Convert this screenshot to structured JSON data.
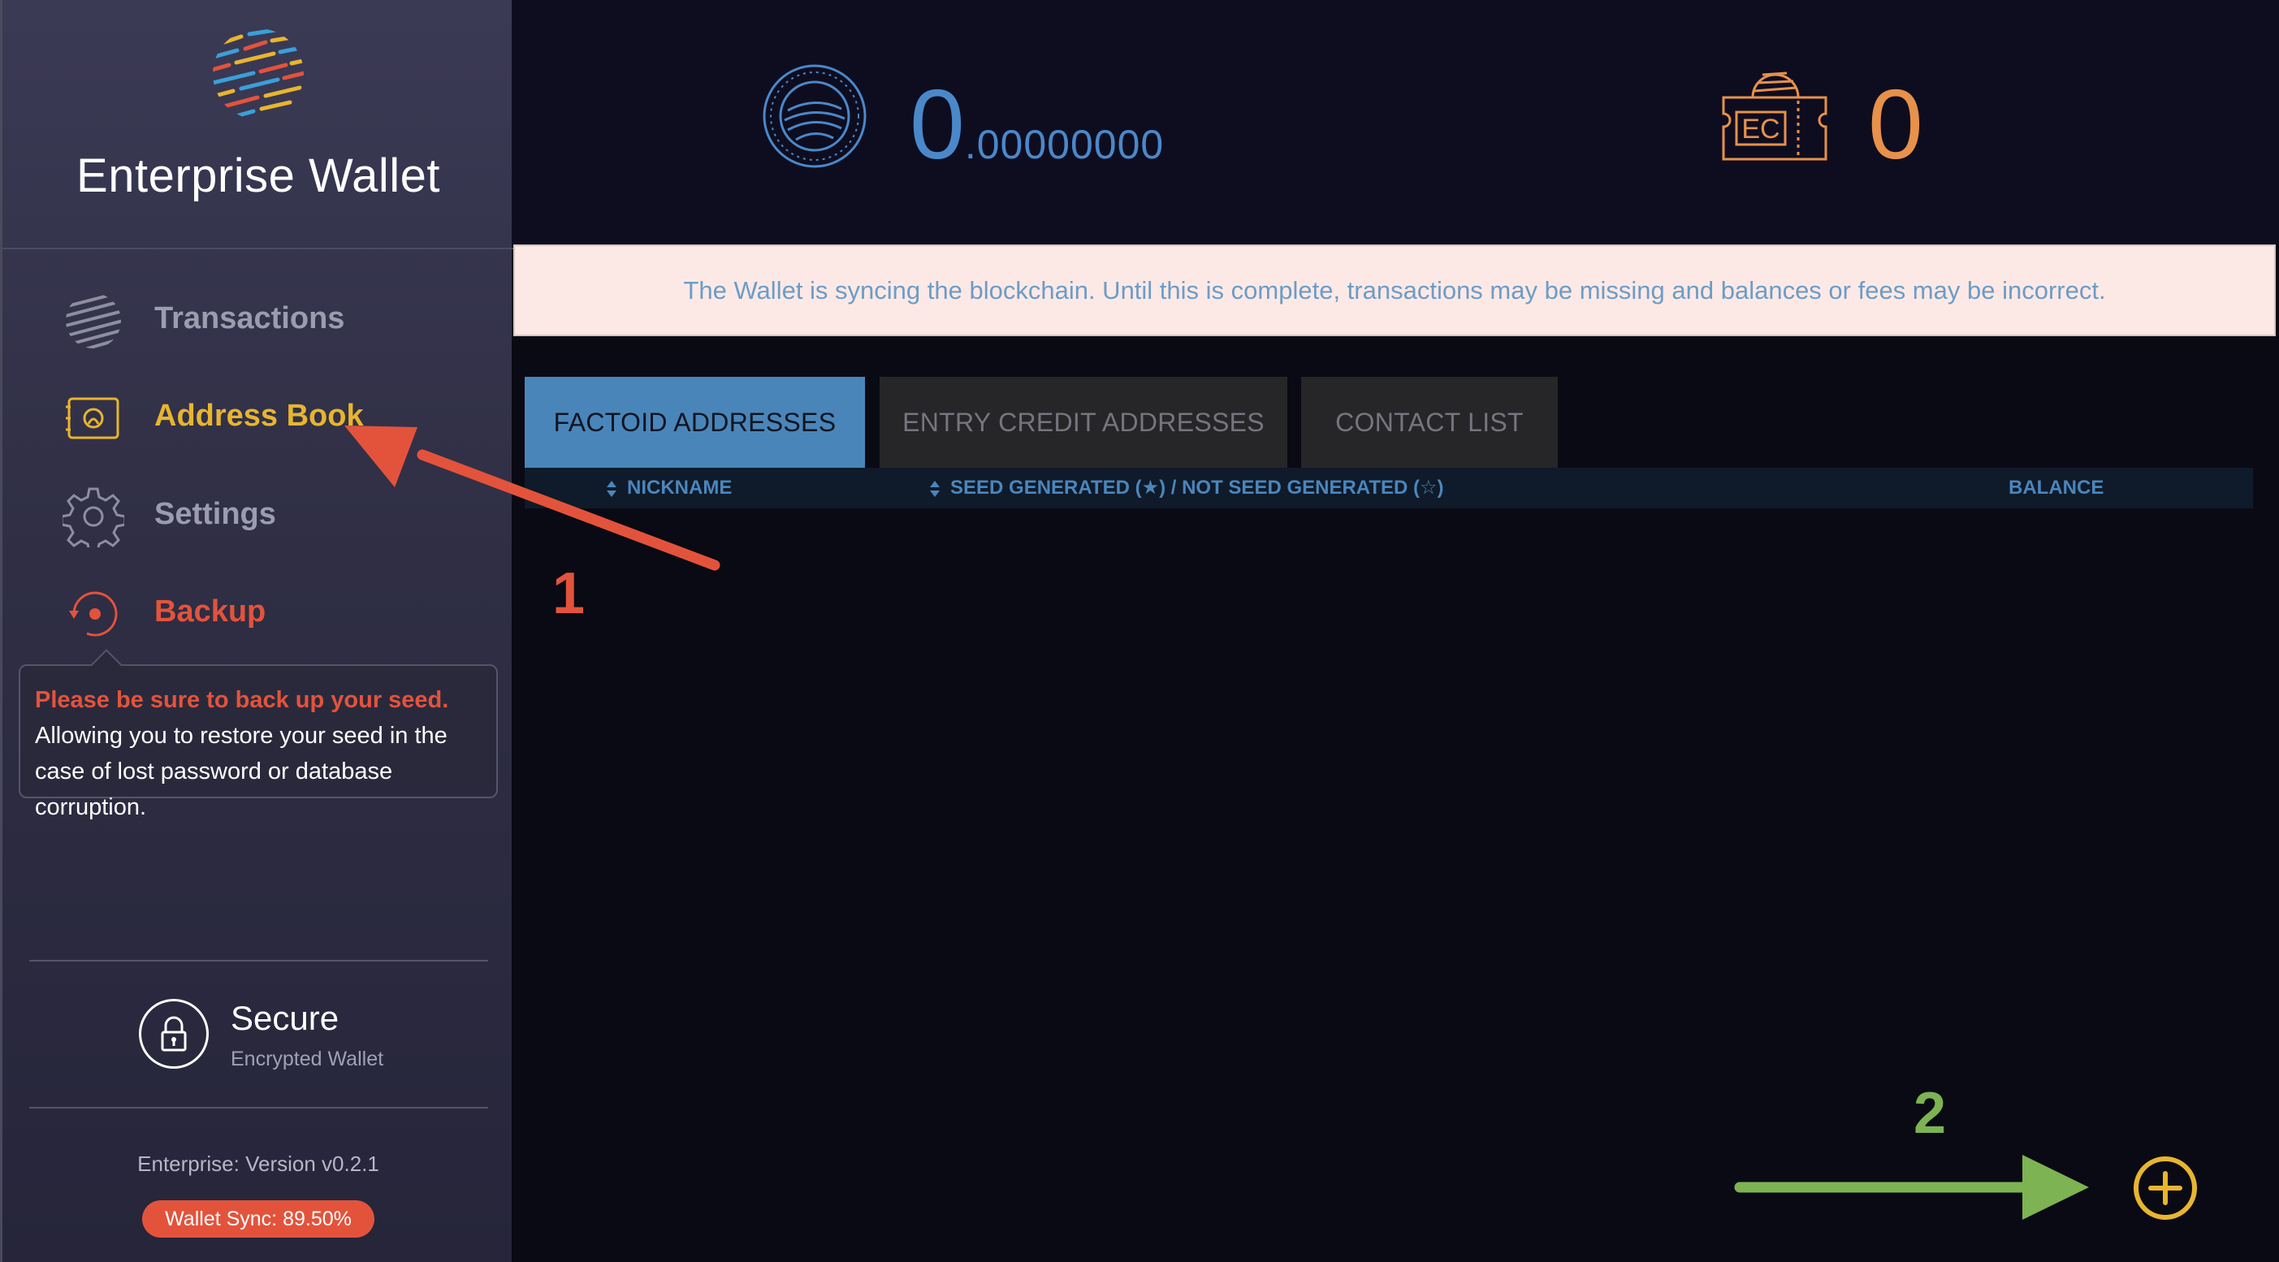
{
  "app": {
    "title": "Enterprise Wallet"
  },
  "sidebar": {
    "items": [
      {
        "label": "Transactions",
        "icon": "globe-icon"
      },
      {
        "label": "Address Book",
        "icon": "address-book-icon"
      },
      {
        "label": "Settings",
        "icon": "gear-icon"
      },
      {
        "label": "Backup",
        "icon": "backup-icon"
      }
    ],
    "tooltip": {
      "warning": "Please be sure to back up your seed.",
      "body": "Allowing you to restore your seed in the case of lost password or database corruption."
    },
    "secure": {
      "title": "Secure",
      "subtitle": "Encrypted Wallet",
      "icon": "lock-icon"
    },
    "version": "Enterprise: Version v0.2.1",
    "sync_badge": "Wallet Sync: 89.50%"
  },
  "balances": {
    "factoid": {
      "integer": "0",
      "decimal": ".00000000",
      "icon": "factoid-coin-icon",
      "color": "#4a88c9"
    },
    "entry_credit": {
      "value": "0",
      "icon": "entry-credit-ticket-icon",
      "badge": "EC",
      "color": "#e7914a"
    }
  },
  "alert": {
    "message": "The Wallet is syncing the blockchain. Until this is complete, transactions may be missing and balances or fees may be incorrect."
  },
  "tabs": [
    {
      "label": "FACTOID ADDRESSES",
      "active": true
    },
    {
      "label": "ENTRY CREDIT ADDRESSES",
      "active": false
    },
    {
      "label": "CONTACT LIST",
      "active": false
    }
  ],
  "table": {
    "columns": {
      "nickname": "NICKNAME",
      "seed": "SEED GENERATED (★) / NOT SEED GENERATED (☆)",
      "balance": "BALANCE"
    }
  },
  "annotations": {
    "step1": "1",
    "step2": "2"
  },
  "colors": {
    "accent_yellow": "#e8b52e",
    "alert_red": "#e3533b",
    "link_blue": "#4a85b9",
    "annotation_green": "#7db352"
  }
}
